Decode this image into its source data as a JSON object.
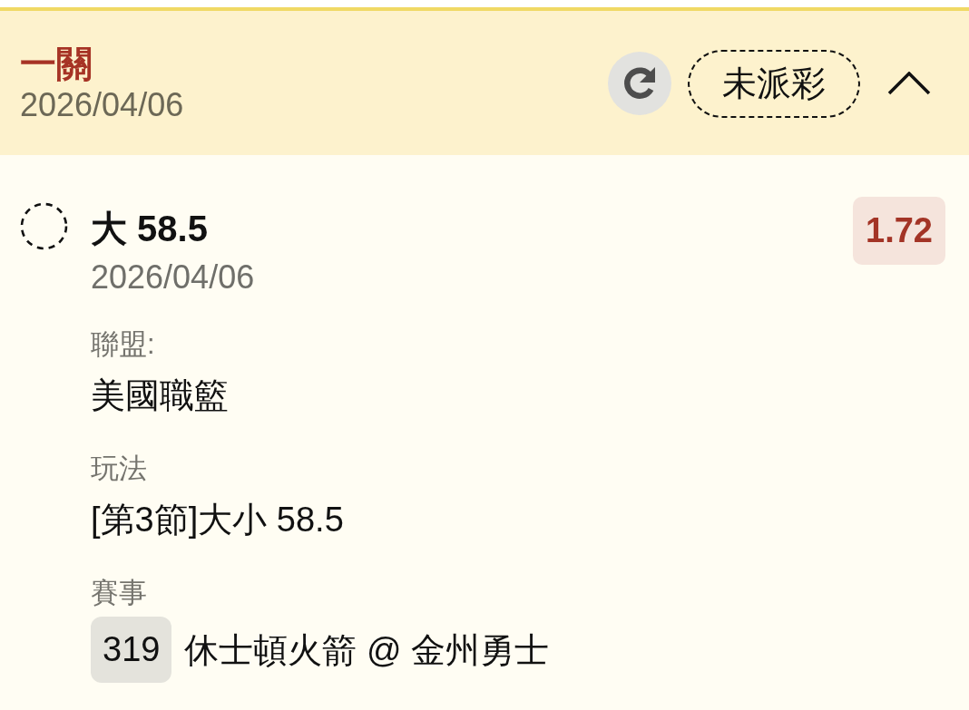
{
  "bet": {
    "type": "一關",
    "date": "2026/04/06",
    "status": "未派彩",
    "expanded": true
  },
  "selection": {
    "name": "大 58.5",
    "date": "2026/04/06",
    "odds": "1.72"
  },
  "details": [
    {
      "kind": "text",
      "label": "聯盟:",
      "value": "美國職籃"
    },
    {
      "kind": "text",
      "label": "玩法",
      "value": "[第3節]大小 58.5"
    },
    {
      "kind": "match",
      "label": "賽事",
      "number": "319",
      "value": "休士頓火箭 @ 金州勇士"
    }
  ]
}
